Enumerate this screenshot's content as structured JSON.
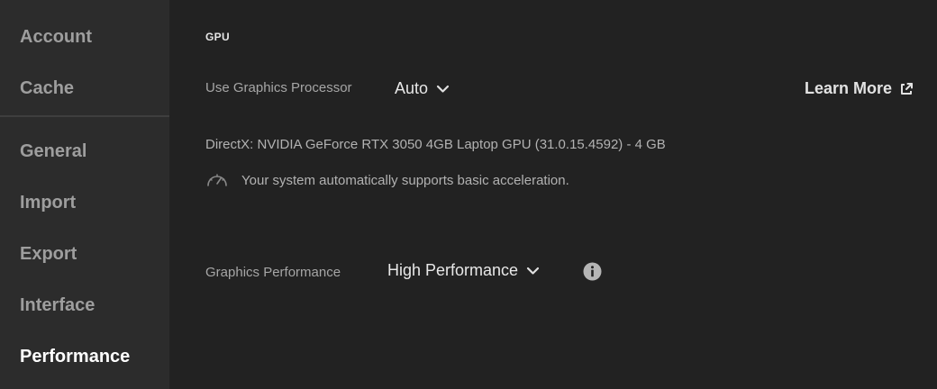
{
  "sidebar": {
    "items": [
      {
        "label": "Account"
      },
      {
        "label": "Cache"
      },
      {
        "label": "General"
      },
      {
        "label": "Import"
      },
      {
        "label": "Export"
      },
      {
        "label": "Interface"
      },
      {
        "label": "Performance",
        "active": true
      }
    ]
  },
  "gpu": {
    "section_title": "GPU",
    "processor_label": "Use Graphics Processor",
    "processor_value": "Auto",
    "learn_more_label": "Learn More",
    "directx_info": "DirectX: NVIDIA GeForce RTX 3050 4GB Laptop GPU (31.0.15.4592) - 4 GB",
    "acceleration_status": "Your system automatically supports basic acceleration.",
    "performance_label": "Graphics Performance",
    "performance_value": "High Performance"
  },
  "icons": {
    "dropdown": "chevron-down-icon",
    "external": "external-link-icon",
    "speedometer": "speedometer-icon",
    "info": "info-icon"
  },
  "colors": {
    "background": "#222222",
    "sidebar_background": "#2c2c2c",
    "active_text": "#ffffff",
    "inactive_text": "#9e9e9e"
  }
}
